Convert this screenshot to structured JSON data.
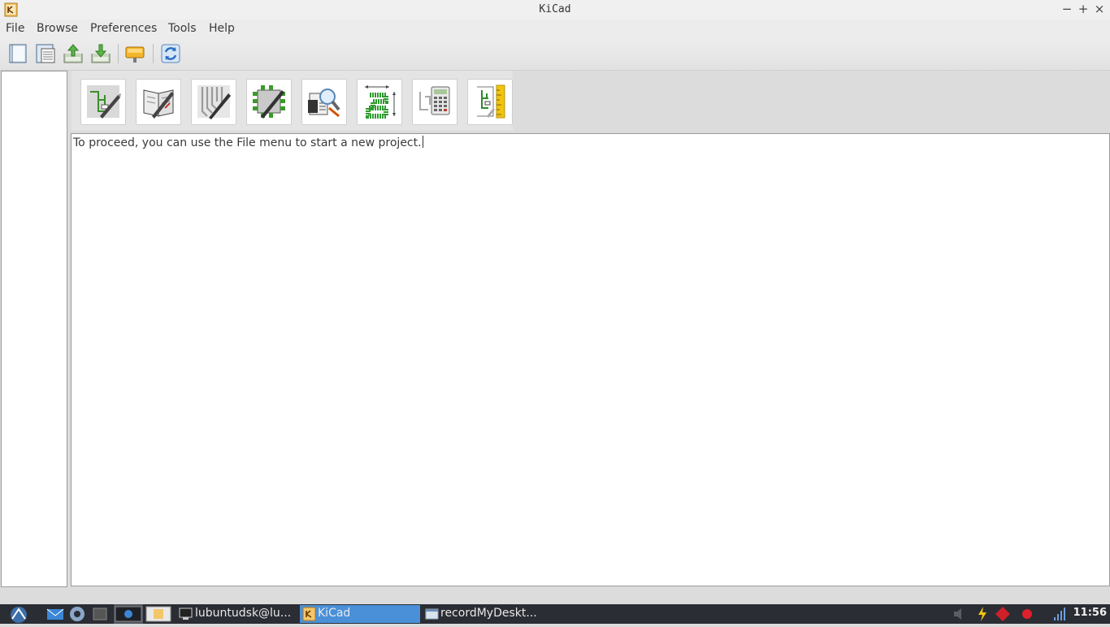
{
  "window": {
    "title": "KiCad"
  },
  "menu": {
    "items": [
      "File",
      "Browse",
      "Preferences",
      "Tools",
      "Help"
    ]
  },
  "toolbar": {
    "icons": [
      "new-project-icon",
      "new-project-from-template-icon",
      "open-project-icon",
      "save-project-icon",
      "archive-icon",
      "refresh-icon"
    ]
  },
  "launchers": [
    "schematic-editor-icon",
    "symbol-editor-icon",
    "pcb-editor-icon",
    "footprint-editor-icon",
    "gerber-viewer-icon",
    "bitmap-converter-icon",
    "calculator-icon",
    "worksheet-editor-icon"
  ],
  "message": {
    "text": "To proceed, you can use the File menu to start a new project."
  },
  "taskbar": {
    "tasks": [
      {
        "label": "lubuntudsk@lu...",
        "icon": "terminal-icon"
      },
      {
        "label": "KiCad",
        "icon": "kicad-icon",
        "active": true
      },
      {
        "label": "recordMyDeskt...",
        "icon": "window-icon"
      }
    ],
    "clock": "11:56"
  },
  "colors": {
    "taskbar_bg": "#2a2d33",
    "active_task": "#4a90d9",
    "window_bg": "#ffffff"
  }
}
